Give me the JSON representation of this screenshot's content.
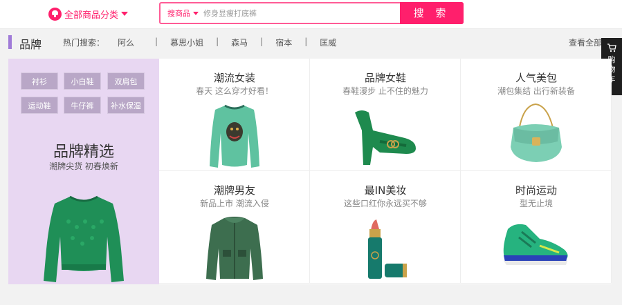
{
  "header": {
    "all_categories": "全部商品分类",
    "search_scope": "搜商品",
    "search_placeholder": "修身显瘦打底裤",
    "search_button": "搜 索"
  },
  "brand_bar": {
    "title": "品牌",
    "hot_label": "热门搜索：",
    "hot_links": [
      "阿么",
      "|",
      "慕思小姐",
      "|",
      "森马",
      "|",
      "宿本",
      "|",
      "匡威"
    ],
    "view_all": "查看全部"
  },
  "cart": {
    "label": "购物车"
  },
  "left_panel": {
    "tags": [
      "衬衫",
      "小白鞋",
      "双肩包",
      "运动鞋",
      "牛仔裤",
      "补水保湿"
    ],
    "title": "品牌精选",
    "subtitle": "潮牌尖货 初春焕新"
  },
  "grid": [
    {
      "title": "潮流女装",
      "subtitle": "春天 这么穿才好看！",
      "image": "green-sweater"
    },
    {
      "title": "品牌女鞋",
      "subtitle": "春鞋漫步 止不住的魅力",
      "image": "green-heel"
    },
    {
      "title": "人气美包",
      "subtitle": "潮包集结 出行新装备",
      "image": "mint-bag"
    },
    {
      "title": "潮牌男友",
      "subtitle": "新品上市 潮流入侵",
      "image": "green-jacket"
    },
    {
      "title": "最IN美妆",
      "subtitle": "这些口红你永远买不够",
      "image": "lipstick"
    },
    {
      "title": "时尚运动",
      "subtitle": "型无止境",
      "image": "sneaker"
    }
  ],
  "colors": {
    "accent": "#ff1f6c",
    "brand_mark": "#a07bd8",
    "left_panel_bg": "#e8d7f2",
    "tag_bg": "#b9a7c7"
  }
}
